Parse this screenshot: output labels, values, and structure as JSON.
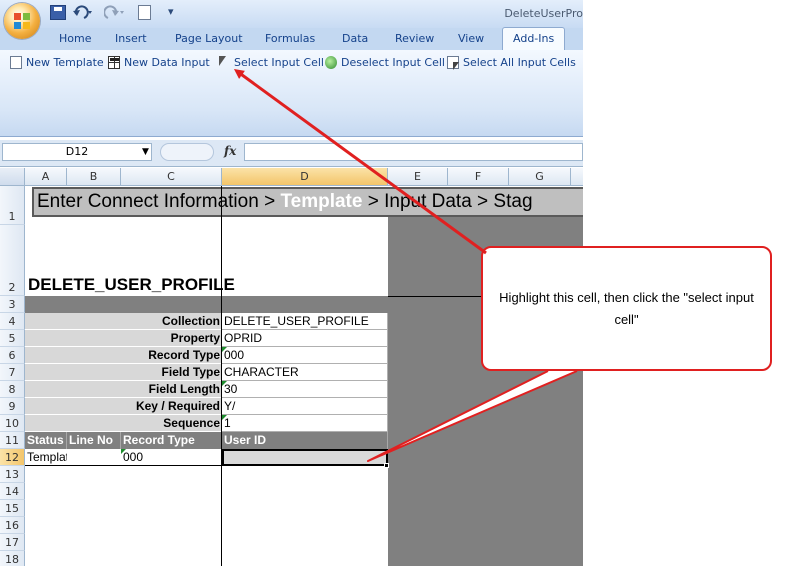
{
  "window": {
    "title": "DeleteUserPro"
  },
  "quick_access": {
    "more": "▾"
  },
  "ribbon": {
    "tabs": [
      "Home",
      "Insert",
      "Page Layout",
      "Formulas",
      "Data",
      "Review",
      "View",
      "Add-Ins"
    ],
    "active_tab": "Add-Ins",
    "buttons": [
      "New Template",
      "New Data Input",
      "Select Input Cell",
      "Deselect Input Cell",
      "Select All Input Cells"
    ]
  },
  "formula_bar": {
    "name_box": "D12",
    "fx": "fx",
    "formula": ""
  },
  "sheet": {
    "columns": [
      "A",
      "B",
      "C",
      "D",
      "E",
      "F",
      "G"
    ],
    "selected_column": "D",
    "rows": [
      "1",
      "2",
      "3",
      "4",
      "5",
      "6",
      "7",
      "8",
      "9",
      "10",
      "11",
      "12",
      "13",
      "14",
      "15",
      "16",
      "17",
      "18"
    ],
    "selected_row": "12",
    "banner": {
      "before": "Enter Connect Information > ",
      "current": "Template",
      "after": " > Input Data > Stag"
    },
    "profile_title": "DELETE_USER_PROFILE",
    "properties": [
      {
        "label": "Collection",
        "value": "DELETE_USER_PROFILE"
      },
      {
        "label": "Property",
        "value": "OPRID"
      },
      {
        "label": "Record Type",
        "value": "000"
      },
      {
        "label": "Field Type",
        "value": "CHARACTER"
      },
      {
        "label": "Field Length",
        "value": "30"
      },
      {
        "label": "Key / Required",
        "value": "Y/"
      },
      {
        "label": "Sequence",
        "value": "1"
      }
    ],
    "header_row": [
      "Status",
      "Line No",
      "Record Type",
      "User ID"
    ],
    "data_row": [
      "Template",
      "",
      "000",
      ""
    ]
  },
  "callout": {
    "text": "Highlight this cell, then click the \"select input cell\""
  },
  "colors": {
    "accent_red": "#e02020",
    "ribbon_text": "#15428b"
  }
}
